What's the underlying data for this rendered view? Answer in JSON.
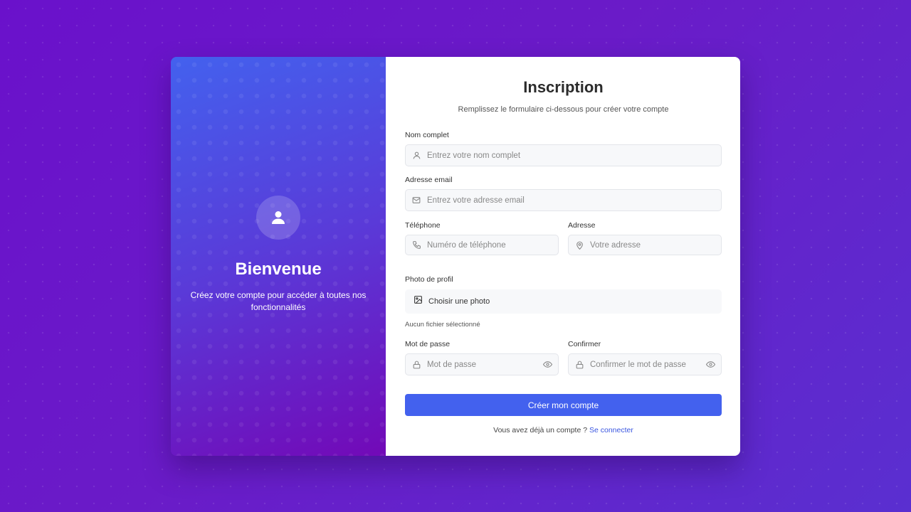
{
  "welcome": {
    "title": "Bienvenue",
    "text": "Créez votre compte pour accéder à toutes nos fonctionnalités"
  },
  "form": {
    "title": "Inscription",
    "subtitle": "Remplissez le formulaire ci-dessous pour créer votre compte",
    "fullname": {
      "label": "Nom complet",
      "placeholder": "Entrez votre nom complet"
    },
    "email": {
      "label": "Adresse email",
      "placeholder": "Entrez votre adresse email"
    },
    "phone": {
      "label": "Téléphone",
      "placeholder": "Numéro de téléphone"
    },
    "address": {
      "label": "Adresse",
      "placeholder": "Votre adresse"
    },
    "photo": {
      "label": "Photo de profil",
      "button": "Choisir une photo",
      "status": "Aucun fichier sélectionné"
    },
    "password": {
      "label": "Mot de passe",
      "placeholder": "Mot de passe"
    },
    "confirm": {
      "label": "Confirmer",
      "placeholder": "Confirmer le mot de passe"
    },
    "submit": "Créer mon compte",
    "login_prompt": "Vous avez déjà un compte ?",
    "login_link": "Se connecter"
  },
  "colors": {
    "accent": "#4361ee",
    "gradient_start": "#4361ee",
    "gradient_end": "#7209b7",
    "background": "#6a11cb"
  },
  "icons": [
    "user-icon",
    "user-outline-icon",
    "mail-icon",
    "phone-icon",
    "map-pin-icon",
    "image-icon",
    "lock-icon",
    "eye-icon"
  ]
}
